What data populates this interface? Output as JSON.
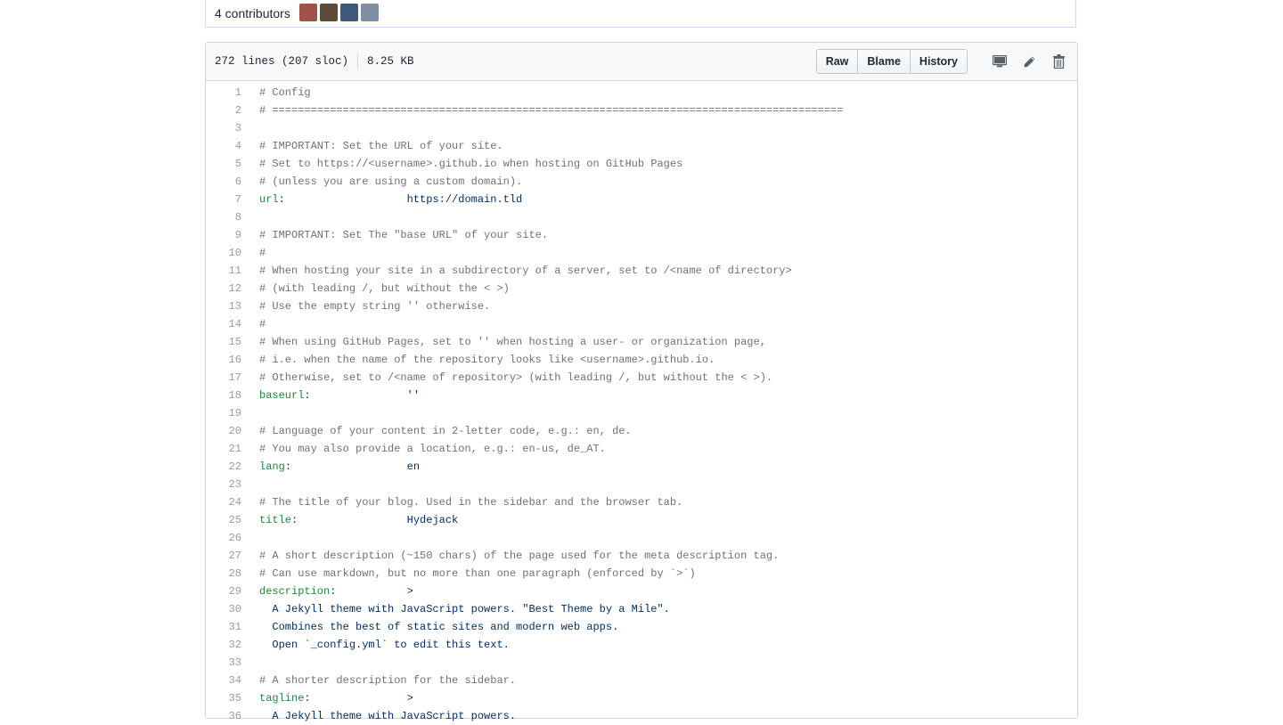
{
  "contributors": {
    "label": "4 contributors",
    "avatar_colors": [
      "#a0524a",
      "#5c4a3a",
      "#3d5a7a",
      "#7d8fa0"
    ]
  },
  "file_info": {
    "lines": "272 lines (207 sloc)",
    "size": "8.25 KB"
  },
  "actions": {
    "raw": "Raw",
    "blame": "Blame",
    "history": "History"
  },
  "icons": [
    "desktop-icon",
    "pencil-icon",
    "trash-icon"
  ],
  "colors": {
    "comment": "#6a737d",
    "key": "#22863a",
    "value": "#032f62"
  },
  "code_lines": [
    {
      "n": "1",
      "c": "# Config"
    },
    {
      "n": "2",
      "c": "# ========================================================================================="
    },
    {
      "n": "3",
      "c": ""
    },
    {
      "n": "4",
      "c": "# IMPORTANT: Set the URL of your site."
    },
    {
      "n": "5",
      "c": "# Set to https://<username>.github.io when hosting on GitHub Pages"
    },
    {
      "n": "6",
      "c": "# (unless you are using a custom domain)."
    },
    {
      "n": "7",
      "k": "url",
      "v": "https://domain.tld"
    },
    {
      "n": "8",
      "c": ""
    },
    {
      "n": "9",
      "c": "# IMPORTANT: Set The \"base URL\" of your site."
    },
    {
      "n": "10",
      "c": "#"
    },
    {
      "n": "11",
      "c": "# When hosting your site in a subdirectory of a server, set to /<name of directory>"
    },
    {
      "n": "12",
      "c": "# (with leading /, but without the < >)"
    },
    {
      "n": "13",
      "c": "# Use the empty string '' otherwise."
    },
    {
      "n": "14",
      "c": "#"
    },
    {
      "n": "15",
      "c": "# When using GitHub Pages, set to '' when hosting a user- or organization page,"
    },
    {
      "n": "16",
      "c": "# i.e. when the name of the repository looks like <username>.github.io."
    },
    {
      "n": "17",
      "c": "# Otherwise, set to /<name of repository> (with leading /, but without the < >)."
    },
    {
      "n": "18",
      "k": "baseurl",
      "v": "''"
    },
    {
      "n": "19",
      "c": ""
    },
    {
      "n": "20",
      "c": "# Language of your content in 2-letter code, e.g.: en, de."
    },
    {
      "n": "21",
      "c": "# You may also provide a location, e.g.: en-us, de_AT."
    },
    {
      "n": "22",
      "k": "lang",
      "v": "en"
    },
    {
      "n": "23",
      "c": ""
    },
    {
      "n": "24",
      "c": "# The title of your blog. Used in the sidebar and the browser tab."
    },
    {
      "n": "25",
      "k": "title",
      "v": "Hydejack"
    },
    {
      "n": "26",
      "c": ""
    },
    {
      "n": "27",
      "c": "# A short description (~150 chars) of the page used for the meta description tag."
    },
    {
      "n": "28",
      "c": "# Can use markdown, but no more than one paragraph (enforced by `>`)"
    },
    {
      "n": "29",
      "k": "description",
      "v": ">"
    },
    {
      "n": "30",
      "t": "  A Jekyll theme with JavaScript powers. \"Best Theme by a Mile\"."
    },
    {
      "n": "31",
      "t": "  Combines the best of static sites and modern web apps."
    },
    {
      "n": "32",
      "t": "  Open `_config.yml` to edit this text."
    },
    {
      "n": "33",
      "c": ""
    },
    {
      "n": "34",
      "c": "# A shorter description for the sidebar."
    },
    {
      "n": "35",
      "k": "tagline",
      "v": ">"
    },
    {
      "n": "36",
      "t": "  A Jekyll theme with JavaScript powers."
    }
  ]
}
